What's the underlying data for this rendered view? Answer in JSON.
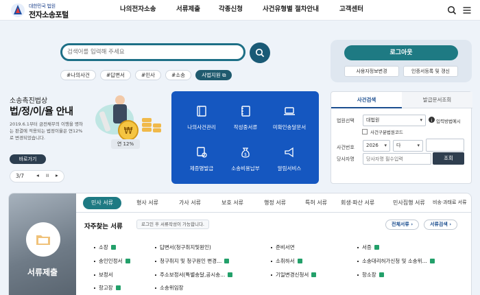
{
  "header": {
    "logo_sub": "대한민국 법원",
    "logo_main": "전자소송포털",
    "nav": [
      "나의전자소송",
      "서류제출",
      "각종신청",
      "사건유형별 절차안내",
      "고객센터"
    ]
  },
  "search": {
    "placeholder": "검색어를 입력해 주세요",
    "chips": [
      "#나의사건",
      "#답변서",
      "#민사",
      "#소송",
      "사법지원"
    ]
  },
  "login": {
    "button": "로그아웃",
    "links": [
      "사용자정보변경",
      "인증서등록 및 갱신"
    ]
  },
  "promo": {
    "small": "소송촉진법상",
    "big": "법/정/이/율 안내",
    "desc": "2019.6.1부터 금전채무의 이행을 명하는 판결에 적용되는 법정이율은 연12%로 변경되었습니다.",
    "more": "바로가기",
    "page": "3/7",
    "rate": "연 12%"
  },
  "services": [
    {
      "label": "나의사건관리",
      "icon": "book-icon"
    },
    {
      "label": "작성중서류",
      "icon": "notebook-icon"
    },
    {
      "label": "미확인송달문서",
      "icon": "laptop-icon"
    },
    {
      "label": "제증명발급",
      "icon": "certificate-icon"
    },
    {
      "label": "소송비용납부",
      "icon": "money-bag-icon"
    },
    {
      "label": "알림서비스",
      "icon": "megaphone-icon"
    }
  ],
  "case_search": {
    "tabs": [
      "사건검색",
      "발급문서조회"
    ],
    "court_label": "법원선택",
    "court_value": "대법원",
    "court_help": "입력방법예시",
    "prev_court": "사건구분법원코드",
    "case_no_label": "사건번호",
    "year": "2026",
    "type": "다",
    "party_label": "당사자명",
    "party_placeholder": "당사자명 필수입력",
    "search_btn": "조회"
  },
  "documents": {
    "side_title": "서류제출",
    "tabs": [
      "민사 서류",
      "형사 서류",
      "가사 서류",
      "보호 서류",
      "행정 서류",
      "특허 서류",
      "회생·파산 서류",
      "민사집행 서류",
      "비송·과태료 서류"
    ],
    "freq_title": "자주찾는 서류",
    "freq_note": "로그인 후 서류작성이 가능합니다.",
    "all_docs": "전체서류",
    "doc_search": "서류검색",
    "items": [
      {
        "label": "소장",
        "file": true
      },
      {
        "label": "답변서(청구취지및원인)",
        "file": true
      },
      {
        "label": "준비서면",
        "file": false
      },
      {
        "label": "서증",
        "file": true
      },
      {
        "label": "송인인정서",
        "file": true
      },
      {
        "label": "청구취지 및 청구원인 변경...",
        "file": true
      },
      {
        "label": "소취하서",
        "file": true
      },
      {
        "label": "소송대리허가신청 및 소송위...",
        "file": true
      },
      {
        "label": "보정서",
        "file": false
      },
      {
        "label": "주소보정서(특별송달,공시송...",
        "file": true
      },
      {
        "label": "기일변경신청서",
        "file": true
      },
      {
        "label": "항소장",
        "file": true
      },
      {
        "label": "항고장",
        "file": true
      },
      {
        "label": "소송위임장",
        "file": false
      }
    ]
  }
}
